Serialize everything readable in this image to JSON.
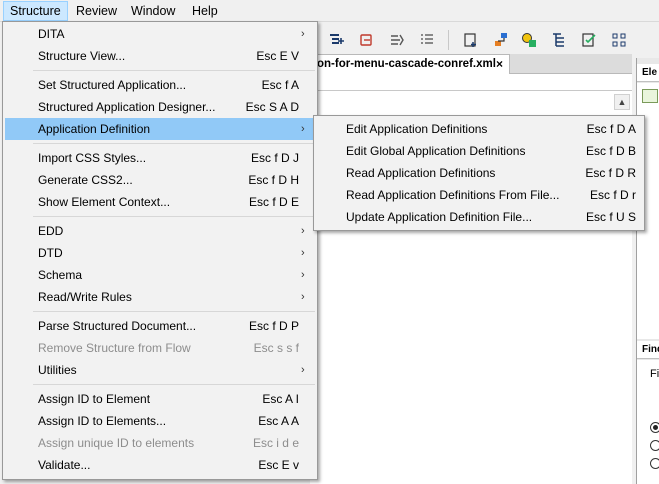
{
  "menubar": {
    "items": [
      "Structure",
      "Review",
      "Window",
      "Help"
    ]
  },
  "document": {
    "tab_title": "on-for-menu-cascade-conref.xml",
    "tab_close": "×"
  },
  "right_panel": {
    "top_header": "Ele",
    "bottom_header": "Find",
    "bottom_label": "Fi"
  },
  "toolbar": {
    "icons": [
      "insert-element-icon",
      "wrap-element-icon",
      "change-element-icon",
      "list-icon",
      "insert-table-icon",
      "structure-tree-icon",
      "element-catalog-icon",
      "hierarchy-icon",
      "validate-icon",
      "grid-icon"
    ]
  },
  "structure_menu": {
    "items": [
      {
        "label": "DITA",
        "shortcut": "",
        "submenu": true,
        "disabled": false
      },
      {
        "label": "Structure View...",
        "shortcut": "Esc E V",
        "submenu": false,
        "disabled": false
      },
      {
        "label": "Set Structured Application...",
        "shortcut": "Esc f A",
        "submenu": false,
        "disabled": false
      },
      {
        "label": "Structured Application Designer...",
        "shortcut": "Esc S A D",
        "submenu": false,
        "disabled": false
      },
      {
        "label": "Application Definition",
        "shortcut": "",
        "submenu": true,
        "disabled": false
      },
      {
        "label": "Import CSS Styles...",
        "shortcut": "Esc f D J",
        "submenu": false,
        "disabled": false
      },
      {
        "label": "Generate CSS2...",
        "shortcut": "Esc f D H",
        "submenu": false,
        "disabled": false
      },
      {
        "label": "Show Element Context...",
        "shortcut": "Esc f D E",
        "submenu": false,
        "disabled": false
      },
      {
        "label": "EDD",
        "shortcut": "",
        "submenu": true,
        "disabled": false
      },
      {
        "label": "DTD",
        "shortcut": "",
        "submenu": true,
        "disabled": false
      },
      {
        "label": "Schema",
        "shortcut": "",
        "submenu": true,
        "disabled": false
      },
      {
        "label": "Read/Write Rules",
        "shortcut": "",
        "submenu": true,
        "disabled": false
      },
      {
        "label": "Parse Structured Document...",
        "shortcut": "Esc f D P",
        "submenu": false,
        "disabled": false
      },
      {
        "label": "Remove Structure from Flow",
        "shortcut": "Esc s s f",
        "submenu": false,
        "disabled": true
      },
      {
        "label": "Utilities",
        "shortcut": "",
        "submenu": true,
        "disabled": false
      },
      {
        "label": "Assign ID to Element",
        "shortcut": "Esc A I",
        "submenu": false,
        "disabled": false
      },
      {
        "label": "Assign ID to Elements...",
        "shortcut": "Esc A A",
        "submenu": false,
        "disabled": false
      },
      {
        "label": "Assign unique ID to elements",
        "shortcut": "Esc i d e",
        "submenu": false,
        "disabled": true
      },
      {
        "label": "Validate...",
        "shortcut": "Esc E v",
        "submenu": false,
        "disabled": false
      }
    ]
  },
  "application_definition_submenu": {
    "items": [
      {
        "label": "Edit Application Definitions",
        "shortcut": "Esc f D A"
      },
      {
        "label": "Edit Global Application Definitions",
        "shortcut": "Esc f D B"
      },
      {
        "label": "Read Application Definitions",
        "shortcut": "Esc f D R"
      },
      {
        "label": "Read Application Definitions From File...",
        "shortcut": "Esc f D r"
      },
      {
        "label": "Update Application Definition File...",
        "shortcut": "Esc f U S"
      }
    ]
  },
  "colors": {
    "highlight": "#91c9f7",
    "menu_bg": "#f2f2f2",
    "disabled_text": "#8d8d8d"
  }
}
